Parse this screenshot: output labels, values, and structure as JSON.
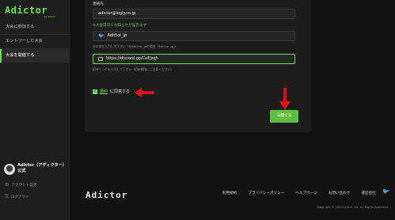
{
  "sidebar": {
    "logo": "Adictor",
    "logo_sub": "by LOGLY",
    "items": [
      {
        "label": "大会に参加する"
      },
      {
        "label": "エントリーした大会"
      },
      {
        "label": "大会を開催する"
      }
    ],
    "user_name": "Adictor（アディクター）公式",
    "account_settings": "アカウント設定",
    "logout": "ログアウト"
  },
  "form": {
    "contact_label": "連絡先",
    "email_value": "adictor@logly.co.jp",
    "notice_label": "※大会前日にお知らせが届きます",
    "twitter_value": "Adictor_jp",
    "twitter_hint": "@の後を入力して下さい（@Adictor_jpの場合「Adictor_jp」）",
    "discord_value": "https://discord.gg/CeEJzqh",
    "discord_hint": "招待リンクを入力して下さい（招待期限にご注意ください）",
    "terms_link": "規約",
    "terms_text": "に同意する",
    "checkbox_mark": "✓",
    "submit_label": "公開する"
  },
  "footer": {
    "logo": "Adictor",
    "links": [
      "利用規約",
      "プライバシーポリシー",
      "ヘルプページ",
      "お問い合わせ",
      "運営会社"
    ],
    "copyright": "Copyright © 2020 LOGLY, Inc. All Rights Reserved."
  },
  "icons": {
    "twitter": "twitter-icon",
    "discord": "discord-icon",
    "gear": "gear-icon",
    "logout": "logout-icon"
  },
  "colors": {
    "accent": "#6ee04a",
    "button": "#5fbf3f",
    "annotation_arrow": "#e01010"
  }
}
